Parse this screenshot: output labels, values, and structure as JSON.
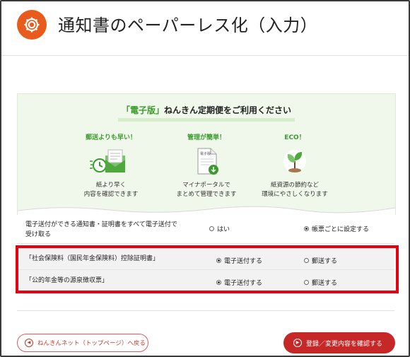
{
  "header": {
    "title": "通知書のペーパーレス化（入力）",
    "icon": "gear-icon",
    "icon_color": "#e85b1c"
  },
  "promo": {
    "heading_highlight": "「電子版」",
    "heading_rest": "ねんきん定期便をご利用ください",
    "features": [
      {
        "title": "郵送よりも早い！",
        "icon": "envelope-clock-icon",
        "desc_line1": "紙より早く",
        "desc_line2": "内容を確認できます"
      },
      {
        "title": "管理が簡単！",
        "icon": "document-download-icon",
        "icon_label": "電子版",
        "desc_line1": "マイナポータルで",
        "desc_line2": "まとめて管理できます"
      },
      {
        "title": "ECO！",
        "icon": "sprout-icon",
        "desc_line1": "紙資源の節約など",
        "desc_line2": "環境にやさしくなります"
      }
    ],
    "accent_color": "#3a9b2d"
  },
  "settings": {
    "rows": [
      {
        "label_line1": "電子送付ができる通知書・証明書をすべて電子送付で",
        "label_line2": "受け取る",
        "option1": "はい",
        "option1_selected": false,
        "option2": "帳票ごとに設定する",
        "option2_selected": true
      },
      {
        "label": "「社会保険料（国民年金保険料）控除証明書」",
        "option1": "電子送付する",
        "option1_selected": true,
        "option2": "郵送する",
        "option2_selected": false
      },
      {
        "label": "「公的年金等の源泉徴収票」",
        "option1": "電子送付する",
        "option1_selected": true,
        "option2": "郵送する",
        "option2_selected": false
      }
    ],
    "highlight_color": "#e60012"
  },
  "footer": {
    "back_label": "ねんきんネット（トップページ）へ戻る",
    "submit_label": "登録／変更内容を確認する",
    "submit_color": "#c62828"
  }
}
